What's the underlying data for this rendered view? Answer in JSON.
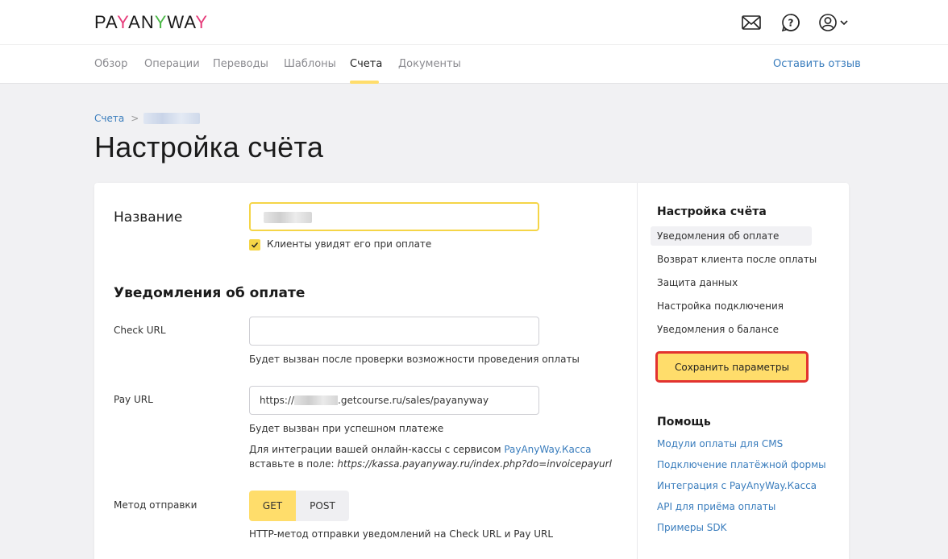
{
  "brand": {
    "logo_parts": [
      "PA",
      "Y",
      "AN",
      "Y",
      "WA",
      "Y"
    ]
  },
  "header": {
    "icons": [
      "mail-icon",
      "help-icon",
      "user-icon",
      "chevron-down-icon"
    ]
  },
  "nav": {
    "items": [
      "Обзор",
      "Операции",
      "Переводы",
      "Шаблоны",
      "Счета",
      "Документы"
    ],
    "active": "Счета",
    "feedback": "Оставить отзыв"
  },
  "breadcrumb": {
    "root": "Счета",
    "separator": ">"
  },
  "page": {
    "title": "Настройка счёта"
  },
  "form": {
    "name_label": "Название",
    "client_sees_label": "Клиенты увидят его при оплате",
    "client_sees_checked": true,
    "notifications_title": "Уведомления об оплате",
    "check_url": {
      "label": "Check URL",
      "value": "",
      "hint": "Будет вызван после проверки возможности проведения оплаты"
    },
    "pay_url": {
      "label": "Pay URL",
      "value_prefix": "https://",
      "value_suffix": ".getcourse.ru/sales/payanyway",
      "hint": "Будет вызван при успешном платеже",
      "integration_text_1": "Для интеграции вашей онлайн-кассы с сервисом ",
      "integration_link": "PayAnyWay.Касса",
      "integration_text_2": "вставьте в поле: ",
      "integration_url": "https://kassa.payanyway.ru/index.php?do=invoicepayurl"
    },
    "method": {
      "label": "Метод отправки",
      "options": [
        "GET",
        "POST"
      ],
      "selected": "GET",
      "hint": "HTTP-метод отправки уведомлений на Check URL и Pay URL"
    }
  },
  "sidebar": {
    "title": "Настройка счёта",
    "items": [
      "Уведомления об оплате",
      "Возврат клиента после оплаты",
      "Защита данных",
      "Настройка подключения",
      "Уведомления о балансе"
    ],
    "active_index": 0,
    "save_label": "Сохранить параметры",
    "help_title": "Помощь",
    "help_links": [
      "Модули оплаты для CMS",
      "Подключение платёжной формы",
      "Интеграция с PayAnyWay.Касса",
      "API для приёма оплаты",
      "Примеры SDK"
    ]
  },
  "colors": {
    "accent_yellow": "#ffdd6b",
    "link_blue": "#3a7dbd",
    "highlight_red": "#e2322f"
  }
}
